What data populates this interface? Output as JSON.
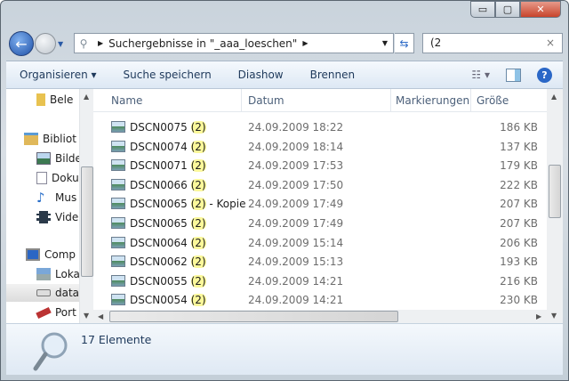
{
  "window": {
    "minimize": "▭",
    "maximize": "▢",
    "close": "✕"
  },
  "address": {
    "path": "Suchergebnisse in \"_aaa_loeschen\""
  },
  "search": {
    "value": "(2",
    "clear": "×"
  },
  "toolbar": {
    "organize": "Organisieren ▾",
    "save_search": "Suche speichern",
    "slideshow": "Diashow",
    "burn": "Brennen"
  },
  "nav": [
    {
      "label": "Bele",
      "icon": "folder-icon"
    },
    {
      "label": "Bibliot",
      "icon": "library-icon"
    },
    {
      "label": "Bilde",
      "icon": "pictures-icon"
    },
    {
      "label": "Doku",
      "icon": "documents-icon"
    },
    {
      "label": "Mus",
      "icon": "music-icon"
    },
    {
      "label": "Vide",
      "icon": "video-icon"
    },
    {
      "label": "Comp",
      "icon": "computer-icon"
    },
    {
      "label": "Loka",
      "icon": "local-disk-icon"
    },
    {
      "label": "data",
      "icon": "drive-icon"
    },
    {
      "label": "Port",
      "icon": "usb-drive-icon"
    }
  ],
  "columns": {
    "name": "Name",
    "date": "Datum",
    "tags": "Markierungen",
    "size": "Größe"
  },
  "files": [
    {
      "base": "DSCN0075 ",
      "match": "(2)",
      "suffix": "",
      "date": "24.09.2009 18:22",
      "size": "186 KB"
    },
    {
      "base": "DSCN0074 ",
      "match": "(2)",
      "suffix": "",
      "date": "24.09.2009 18:14",
      "size": "137 KB"
    },
    {
      "base": "DSCN0071 ",
      "match": "(2)",
      "suffix": "",
      "date": "24.09.2009 17:53",
      "size": "179 KB"
    },
    {
      "base": "DSCN0066 ",
      "match": "(2)",
      "suffix": "",
      "date": "24.09.2009 17:50",
      "size": "222 KB"
    },
    {
      "base": "DSCN0065 ",
      "match": "(2)",
      "suffix": " - Kopie",
      "date": "24.09.2009 17:49",
      "size": "207 KB"
    },
    {
      "base": "DSCN0065 ",
      "match": "(2)",
      "suffix": "",
      "date": "24.09.2009 17:49",
      "size": "207 KB"
    },
    {
      "base": "DSCN0064 ",
      "match": "(2)",
      "suffix": "",
      "date": "24.09.2009 15:14",
      "size": "206 KB"
    },
    {
      "base": "DSCN0062 ",
      "match": "(2)",
      "suffix": "",
      "date": "24.09.2009 15:13",
      "size": "193 KB"
    },
    {
      "base": "DSCN0055 ",
      "match": "(2)",
      "suffix": "",
      "date": "24.09.2009 14:21",
      "size": "216 KB"
    },
    {
      "base": "DSCN0054 ",
      "match": "(2)",
      "suffix": "",
      "date": "24.09.2009 14:21",
      "size": "230 KB"
    }
  ],
  "status": {
    "count": "17 Elemente"
  }
}
